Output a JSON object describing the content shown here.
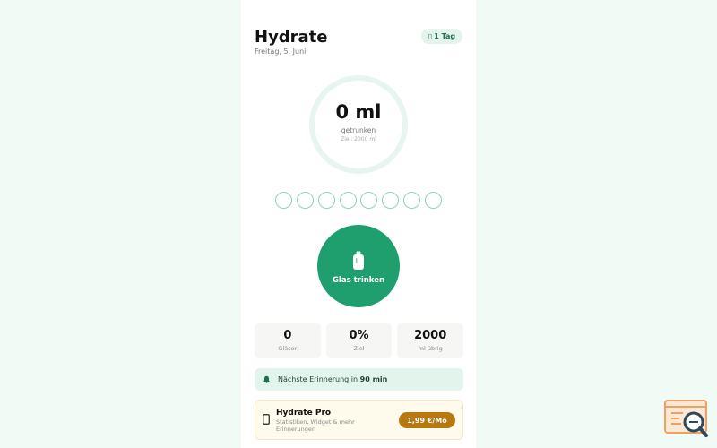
{
  "app": {
    "title": "Hydrate",
    "date": "Freitag, 5. Juni",
    "streak": "1 Tag"
  },
  "progress": {
    "amount": "0 ml",
    "label": "getrunken",
    "goal": "Ziel: 2000 ml",
    "fraction": 0
  },
  "glasses": {
    "total": 8,
    "filled": 0
  },
  "drink_button": {
    "label": "Glas trinken"
  },
  "stats": [
    {
      "value": "0",
      "label": "Gläser"
    },
    {
      "value": "0%",
      "label": "Ziel"
    },
    {
      "value": "2000",
      "label": "ml übrig"
    }
  ],
  "reminder": {
    "prefix": "Nächste Erinnerung in",
    "time": "90 min"
  },
  "pro": {
    "title": "Hydrate Pro",
    "description": "Statistiken, Widget & mehr Erinnerungen",
    "price": "1,99 €/Mo"
  },
  "icons": {
    "streak": "flame-icon",
    "drink": "bottle-icon",
    "reminder": "bell-icon",
    "pro": "phone-icon",
    "corner": "search-logo-icon"
  },
  "colors": {
    "accent": "#1f9e6e",
    "ring_track": "#e6f5ee",
    "glass_outline": "#8fd3b6",
    "pro_button": "#b8770f",
    "background": "#f0fbf6"
  }
}
